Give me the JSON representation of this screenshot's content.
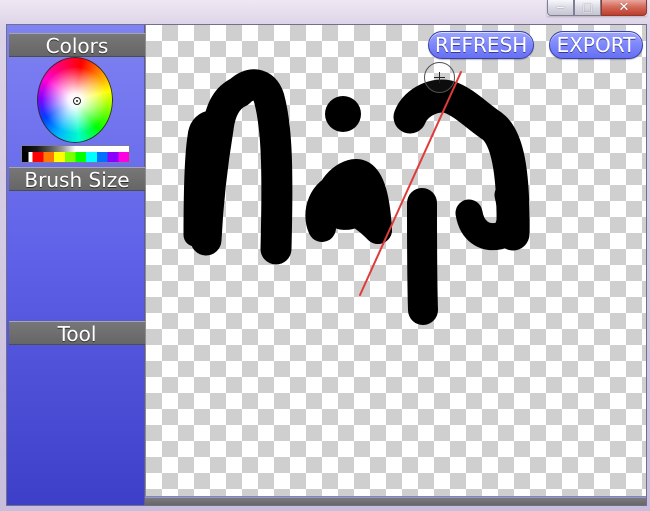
{
  "window": {
    "title": "",
    "controls": {
      "minimize_icon": "window-minimize-icon",
      "maximize_icon": "window-maximize-icon",
      "close_icon": "window-close-icon"
    }
  },
  "sidebar": {
    "colors_label": "Colors",
    "brush_size_label": "Brush Size",
    "tool_label": "Tool"
  },
  "toolbar": {
    "refresh_label": "REFRESH",
    "export_label": "EXPORT"
  },
  "icons": {
    "color_wheel": "color-wheel-icon",
    "palette": "palette-strip-icon",
    "cursor": "crosshair-cursor-icon"
  },
  "colors": {
    "sidebar_top": "#7f82f2",
    "sidebar_bottom": "#3d3fc8",
    "header_gray": "#6f6f6f",
    "button_blue": "#7e87fb",
    "stroke_black": "#000000",
    "annotation_red": "#e03a3a"
  }
}
